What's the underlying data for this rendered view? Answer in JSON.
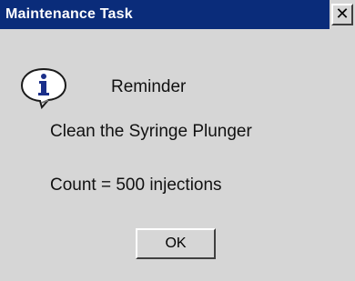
{
  "window": {
    "title": "Maintenance Task",
    "close_glyph": "✕"
  },
  "message": {
    "icon": "info-icon",
    "heading": "Reminder",
    "line1": "Clean the Syringe Plunger",
    "line2": "Count = 500 injections"
  },
  "buttons": {
    "ok_label": "OK"
  },
  "colors": {
    "titlebar": "#0a2c7a",
    "dialog_bg": "#d6d6d6",
    "icon_accent": "#1a2f8a"
  }
}
